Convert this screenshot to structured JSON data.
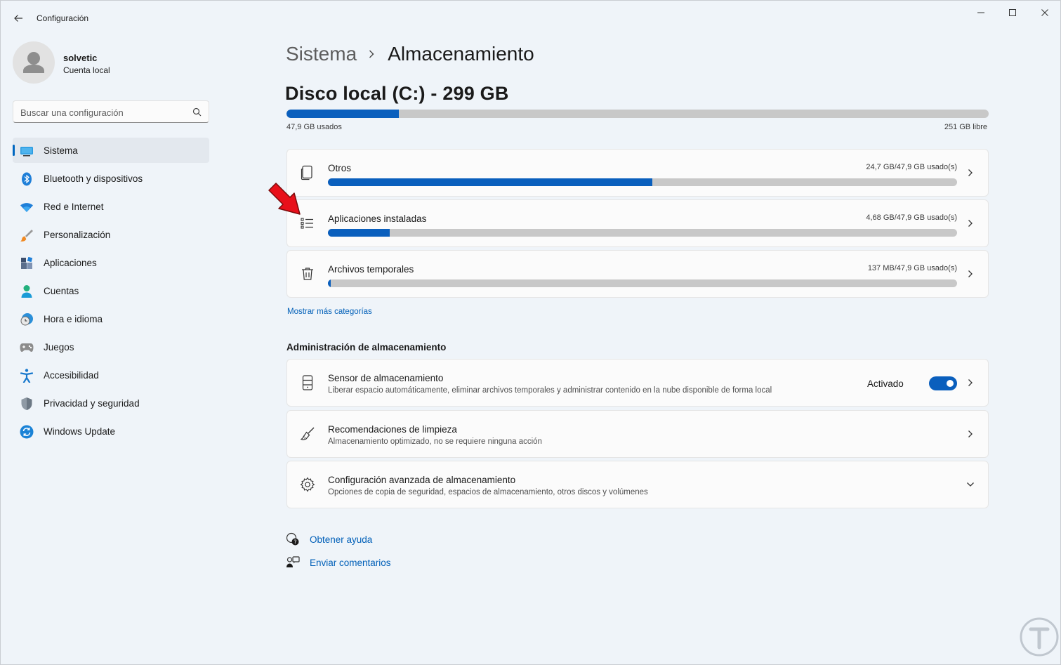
{
  "window": {
    "title": "Configuración"
  },
  "profile": {
    "name": "solvetic",
    "account_type": "Cuenta local"
  },
  "search": {
    "placeholder": "Buscar una configuración"
  },
  "sidebar": {
    "items": [
      {
        "label": "Sistema",
        "icon": "monitor-icon",
        "active": true
      },
      {
        "label": "Bluetooth y dispositivos",
        "icon": "bluetooth-icon"
      },
      {
        "label": "Red e Internet",
        "icon": "wifi-icon"
      },
      {
        "label": "Personalización",
        "icon": "brush-icon"
      },
      {
        "label": "Aplicaciones",
        "icon": "apps-icon"
      },
      {
        "label": "Cuentas",
        "icon": "person-icon"
      },
      {
        "label": "Hora e idioma",
        "icon": "clock-globe-icon"
      },
      {
        "label": "Juegos",
        "icon": "gamepad-icon"
      },
      {
        "label": "Accesibilidad",
        "icon": "accessibility-icon"
      },
      {
        "label": "Privacidad y seguridad",
        "icon": "shield-icon"
      },
      {
        "label": "Windows Update",
        "icon": "update-icon"
      }
    ]
  },
  "breadcrumb": {
    "parent": "Sistema",
    "current": "Almacenamiento"
  },
  "disk": {
    "title": "Disco local (C:) - 299 GB",
    "used_label": "47,9 GB usados",
    "free_label": "251 GB libre",
    "used_fraction": 0.16
  },
  "categories": [
    {
      "title": "Otros",
      "usage": "24,7 GB/47,9 GB usado(s)",
      "fraction": 0.516,
      "icon": "files-icon"
    },
    {
      "title": "Aplicaciones instaladas",
      "usage": "4,68 GB/47,9 GB usado(s)",
      "fraction": 0.098,
      "icon": "list-icon"
    },
    {
      "title": "Archivos temporales",
      "usage": "137 MB/47,9 GB usado(s)",
      "fraction": 0.004,
      "icon": "trash-icon"
    }
  ],
  "more_categories_link": "Mostrar más categorías",
  "management": {
    "section_title": "Administración de almacenamiento",
    "sensor": {
      "title": "Sensor de almacenamiento",
      "subtitle": "Liberar espacio automáticamente, eliminar archivos temporales y administrar contenido en la nube disponible de forma local",
      "toggle_label": "Activado",
      "enabled": true
    },
    "cleanup": {
      "title": "Recomendaciones de limpieza",
      "subtitle": "Almacenamiento optimizado, no se requiere ninguna acción"
    },
    "advanced": {
      "title": "Configuración avanzada de almacenamiento",
      "subtitle": "Opciones de copia de seguridad, espacios de almacenamiento, otros discos y volúmenes"
    }
  },
  "help": {
    "get_help": "Obtener ayuda",
    "feedback": "Enviar comentarios"
  },
  "colors": {
    "accent": "#0a5fbd",
    "annotation_arrow": "#e8101a"
  }
}
